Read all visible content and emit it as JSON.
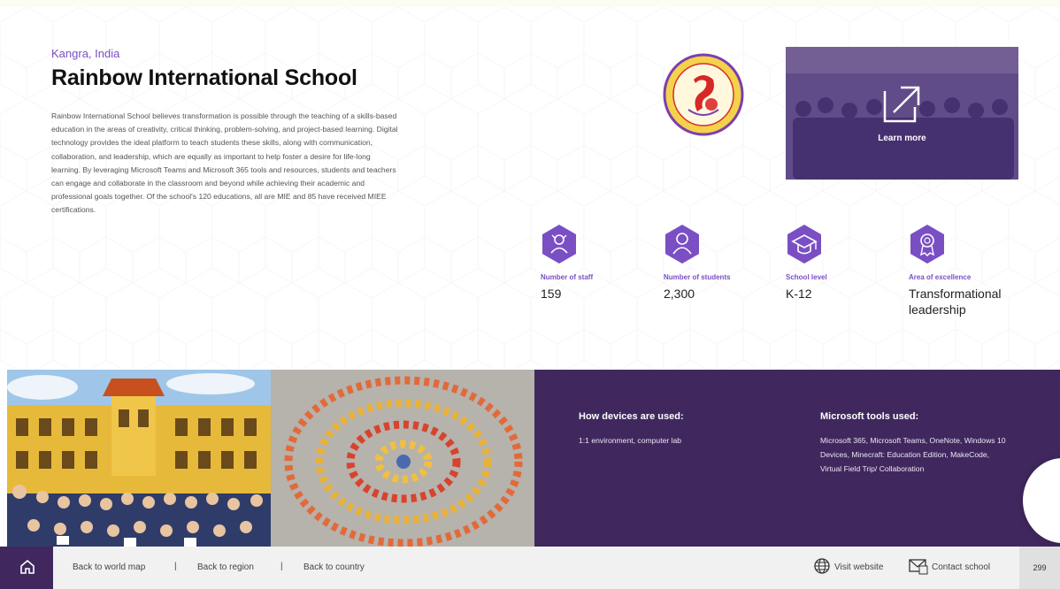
{
  "header": {
    "location": "Kangra, India",
    "title": "Rainbow International School",
    "description": "Rainbow International School believes transformation is possible through the teaching of a skills-based education in the areas of creativity, critical thinking, problem-solving, and project-based learning. Digital technology provides the ideal platform to teach students these skills, along with communication, collaboration, and leadership, which are equally as important to help foster a desire for life-long learning. By leveraging Microsoft Teams and Microsoft 365 tools and resources, students and teachers can engage and collaborate in the classroom and beyond while achieving their academic and professional goals together. Of the school's 120 educations, all are MIE and 85 have received MIEE certifications."
  },
  "learn_more": {
    "label": "Learn more",
    "icon": "external-link-icon"
  },
  "stats": [
    {
      "key": "Number of staff",
      "value": "159",
      "icon": "staff-icon"
    },
    {
      "key": "Number of students",
      "value": "2,300",
      "icon": "student-icon"
    },
    {
      "key": "School level",
      "value": "K-12",
      "icon": "graduation-cap-icon"
    },
    {
      "key": "Area of excellence",
      "value": "Transformational leadership",
      "icon": "award-icon"
    }
  ],
  "devices": {
    "heading": "How devices are used:",
    "text": "1:1 environment, computer lab"
  },
  "tools": {
    "heading": "Microsoft tools used:",
    "text": "Microsoft 365, Microsoft Teams, OneNote, Windows 10 Devices, Minecraft: Education Edition, MakeCode, Virtual Field Trip/ Collaboration"
  },
  "footer": {
    "back_world": "Back to world map",
    "back_region": "Back to region",
    "back_country": "Back to country",
    "visit": "Visit website",
    "contact": "Contact school",
    "page": "299",
    "separator": "|"
  },
  "colors": {
    "accent": "#7a4fc4",
    "panel": "#40285f"
  }
}
